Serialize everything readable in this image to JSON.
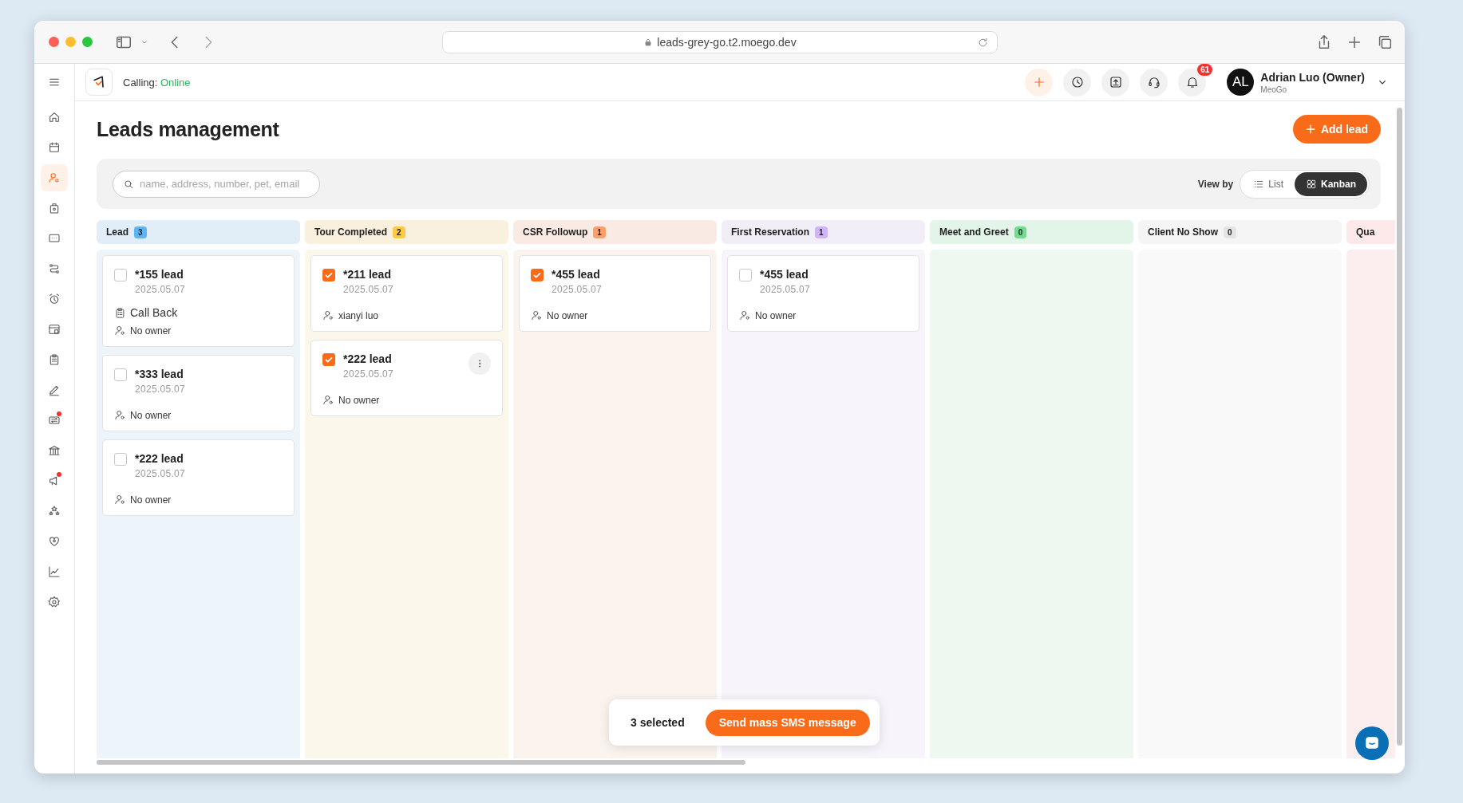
{
  "browser": {
    "url": "leads-grey-go.t2.moego.dev"
  },
  "sidebar": {
    "items": [
      {
        "selected": false,
        "alert": false
      },
      {
        "selected": false,
        "alert": false
      },
      {
        "selected": true,
        "alert": false
      },
      {
        "selected": false,
        "alert": false
      },
      {
        "selected": false,
        "alert": false
      },
      {
        "selected": false,
        "alert": false
      },
      {
        "selected": false,
        "alert": false
      },
      {
        "selected": false,
        "alert": false
      },
      {
        "selected": false,
        "alert": false
      },
      {
        "selected": false,
        "alert": false
      },
      {
        "selected": false,
        "alert": true
      },
      {
        "selected": false,
        "alert": false
      },
      {
        "selected": false,
        "alert": true
      },
      {
        "selected": false,
        "alert": false
      },
      {
        "selected": false,
        "alert": false
      },
      {
        "selected": false,
        "alert": false
      },
      {
        "selected": false,
        "alert": false
      }
    ]
  },
  "top_bar": {
    "calling_label": "Calling:",
    "calling_status": "Online",
    "notification_count": "61",
    "user": {
      "initials": "AL",
      "name": "Adrian Luo (Owner)",
      "company": "MeoGo"
    }
  },
  "page": {
    "title": "Leads management",
    "add_button": "Add lead",
    "search": {
      "placeholder": "name, address, number, pet, email"
    },
    "view_by": {
      "label": "View by",
      "options": [
        {
          "label": "List",
          "selected": false
        },
        {
          "label": "Kanban",
          "selected": true
        }
      ]
    }
  },
  "columns": [
    {
      "name": "Lead",
      "count": "3",
      "color": "#5db4f4",
      "cards": [
        {
          "title": "*155 lead",
          "date": "2025.05.07",
          "checked": false,
          "task": "Call Back",
          "owner": "No owner",
          "menu": false
        },
        {
          "title": "*333 lead",
          "date": "2025.05.07",
          "checked": false,
          "owner": "No owner",
          "menu": false
        },
        {
          "title": "*222 lead",
          "date": "2025.05.07",
          "checked": false,
          "owner": "No owner",
          "menu": false
        }
      ]
    },
    {
      "name": "Tour Completed",
      "count": "2",
      "color": "#fcc94a",
      "cards": [
        {
          "title": "*211 lead",
          "date": "2025.05.07",
          "checked": true,
          "owner": "xianyi luo",
          "menu": false
        },
        {
          "title": "*222 lead",
          "date": "2025.05.07",
          "checked": true,
          "owner": "No owner",
          "menu": true
        }
      ]
    },
    {
      "name": "CSR Followup",
      "count": "1",
      "color": "#fc9f6a",
      "cards": [
        {
          "title": "*455 lead",
          "date": "2025.05.07",
          "checked": true,
          "owner": "No owner",
          "menu": false
        }
      ]
    },
    {
      "name": "First Reservation",
      "count": "1",
      "color": "#d2b3f7",
      "cards": [
        {
          "title": "*455 lead",
          "date": "2025.05.07",
          "checked": false,
          "owner": "No owner",
          "menu": false
        }
      ]
    },
    {
      "name": "Meet and Greet",
      "count": "0",
      "color": "#6ede8e"
    },
    {
      "name": "Client No Show",
      "count": "0",
      "color": "#e4e4e4"
    },
    {
      "name": "Qua",
      "color": "#fde9e9"
    }
  ],
  "selection_bar": {
    "count_text": "3 selected",
    "action": "Send mass SMS message"
  }
}
